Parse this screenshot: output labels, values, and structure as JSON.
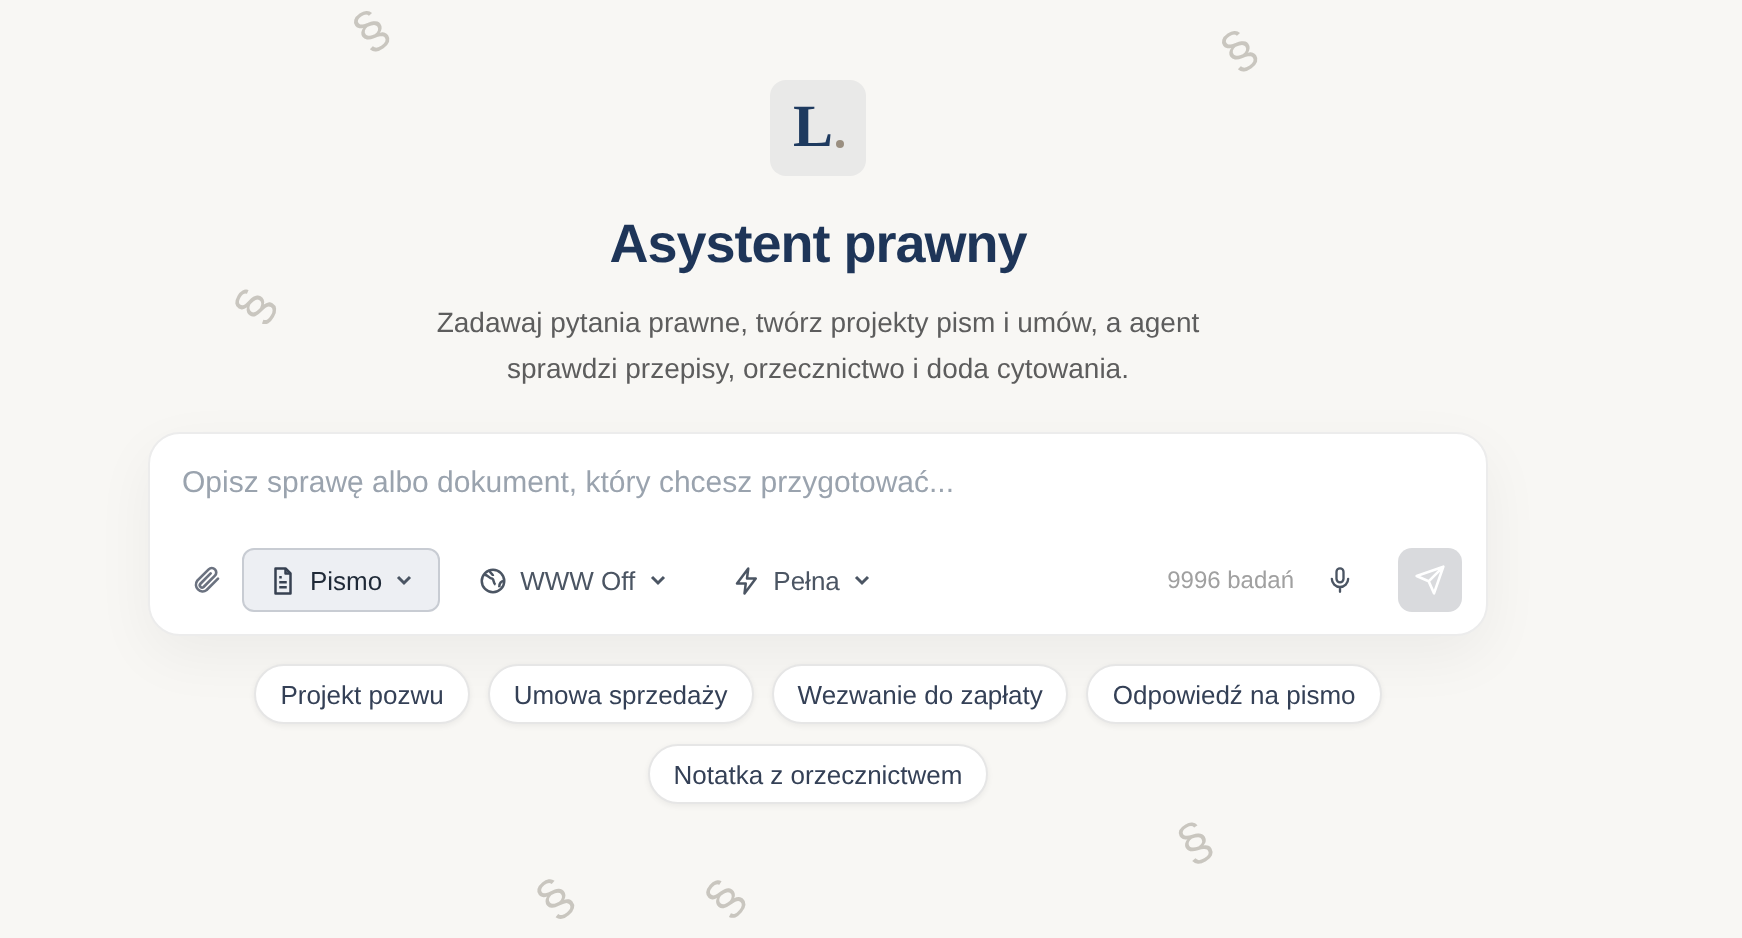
{
  "background_marks": [
    "§",
    "§",
    "§",
    "§",
    "§",
    "§"
  ],
  "logo": {
    "letter": "L"
  },
  "title": "Asystent prawny",
  "subtitle": "Zadawaj pytania prawne, twórz projekty pism i umów, a agent sprawdzi przepisy, orzecznictwo i doda cytowania.",
  "composer": {
    "placeholder": "Opisz sprawę albo dokument, który chcesz przygotować...",
    "controls": [
      {
        "kind": "document",
        "label": "Pismo",
        "selected": true
      },
      {
        "kind": "web",
        "label": "WWW Off",
        "selected": false
      },
      {
        "kind": "speed",
        "label": "Pełna",
        "selected": false
      }
    ],
    "counter": "9996 badań",
    "send_disabled": true
  },
  "suggestions": [
    "Projekt pozwu",
    "Umowa sprzedaży",
    "Wezwanie do zapłaty",
    "Odpowiedź na pismo",
    "Notatka z orzecznictwem"
  ]
}
